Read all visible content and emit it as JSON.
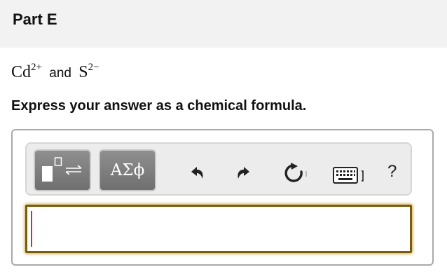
{
  "part": {
    "title": "Part E"
  },
  "question": {
    "ion1_symbol": "Cd",
    "ion1_charge": "2+",
    "connector": "and",
    "ion2_symbol": "S",
    "ion2_charge": "2−"
  },
  "instruction": "Express your answer as a chemical formula.",
  "toolbar": {
    "symbols_label": "ΑΣϕ",
    "help_label": "?",
    "icons": [
      "templates-icon",
      "undo-icon",
      "redo-icon",
      "reset-icon",
      "keyboard-icon"
    ]
  },
  "answer": {
    "value": ""
  },
  "colors": {
    "header_bg": "#f2f2f2",
    "toolbar_button": "#7f7f7f",
    "input_border": "#7a5d0b",
    "caret": "#c0392b"
  }
}
